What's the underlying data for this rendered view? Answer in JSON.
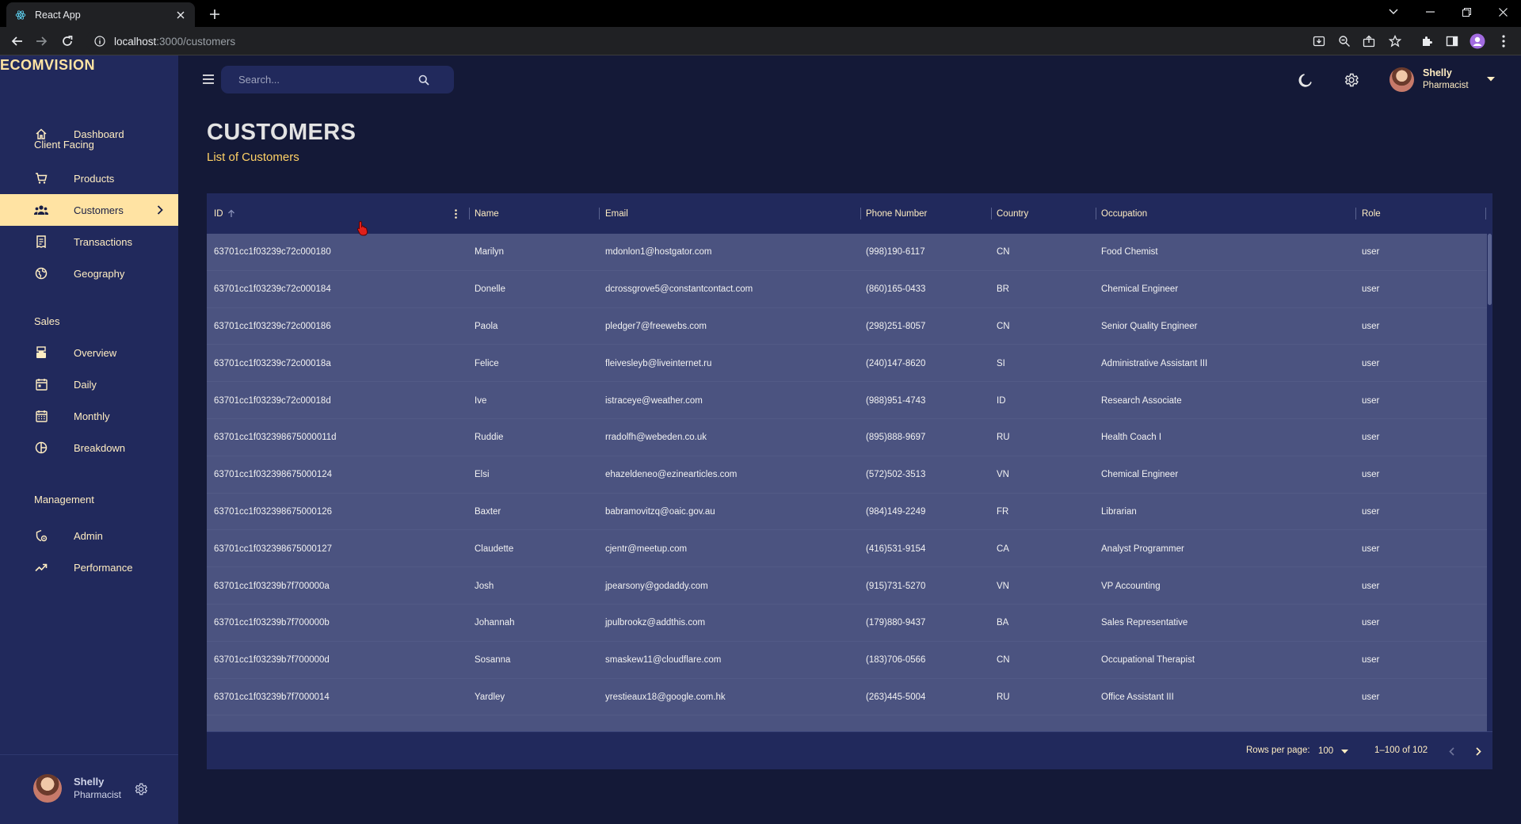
{
  "browser": {
    "tab_title": "React App",
    "url_host": "localhost",
    "url_path": ":3000/customers"
  },
  "sidebar": {
    "brand": "ECOMVISION",
    "items": [
      {
        "label": "Dashboard",
        "icon": "home-icon"
      },
      {
        "section": "Client Facing"
      },
      {
        "label": "Products",
        "icon": "shopping-cart-icon"
      },
      {
        "label": "Customers",
        "icon": "groups-icon",
        "active": true
      },
      {
        "label": "Transactions",
        "icon": "receipt-icon"
      },
      {
        "label": "Geography",
        "icon": "globe-icon"
      },
      {
        "section": "Sales"
      },
      {
        "label": "Overview",
        "icon": "point-of-sale-icon"
      },
      {
        "label": "Daily",
        "icon": "calendar-today-icon"
      },
      {
        "label": "Monthly",
        "icon": "calendar-month-icon"
      },
      {
        "label": "Breakdown",
        "icon": "pie-chart-icon"
      },
      {
        "section": "Management"
      },
      {
        "label": "Admin",
        "icon": "admin-panel-icon"
      },
      {
        "label": "Performance",
        "icon": "trending-up-icon"
      }
    ],
    "user": {
      "name": "Shelly",
      "role": "Pharmacist"
    }
  },
  "topbar": {
    "search_placeholder": "Search...",
    "user": {
      "name": "Shelly",
      "role": "Pharmacist"
    }
  },
  "header": {
    "title": "CUSTOMERS",
    "subtitle": "List of Customers"
  },
  "grid": {
    "columns": [
      "ID",
      "Name",
      "Email",
      "Phone Number",
      "Country",
      "Occupation",
      "Role"
    ],
    "rows": [
      [
        "63701cc1f03239c72c000180",
        "Marilyn",
        "mdonlon1@hostgator.com",
        "(998)190-6117",
        "CN",
        "Food Chemist",
        "user"
      ],
      [
        "63701cc1f03239c72c000184",
        "Donelle",
        "dcrossgrove5@constantcontact.com",
        "(860)165-0433",
        "BR",
        "Chemical Engineer",
        "user"
      ],
      [
        "63701cc1f03239c72c000186",
        "Paola",
        "pledger7@freewebs.com",
        "(298)251-8057",
        "CN",
        "Senior Quality Engineer",
        "user"
      ],
      [
        "63701cc1f03239c72c00018a",
        "Felice",
        "fleivesleyb@liveinternet.ru",
        "(240)147-8620",
        "SI",
        "Administrative Assistant III",
        "user"
      ],
      [
        "63701cc1f03239c72c00018d",
        "Ive",
        "istraceye@weather.com",
        "(988)951-4743",
        "ID",
        "Research Associate",
        "user"
      ],
      [
        "63701cc1f032398675000011d",
        "Ruddie",
        "rradolfh@webeden.co.uk",
        "(895)888-9697",
        "RU",
        "Health Coach I",
        "user"
      ],
      [
        "63701cc1f032398675000124",
        "Elsi",
        "ehazeldeneo@ezinearticles.com",
        "(572)502-3513",
        "VN",
        "Chemical Engineer",
        "user"
      ],
      [
        "63701cc1f032398675000126",
        "Baxter",
        "babramovitzq@oaic.gov.au",
        "(984)149-2249",
        "FR",
        "Librarian",
        "user"
      ],
      [
        "63701cc1f032398675000127",
        "Claudette",
        "cjentr@meetup.com",
        "(416)531-9154",
        "CA",
        "Analyst Programmer",
        "user"
      ],
      [
        "63701cc1f03239b7f700000a",
        "Josh",
        "jpearsony@godaddy.com",
        "(915)731-5270",
        "VN",
        "VP Accounting",
        "user"
      ],
      [
        "63701cc1f03239b7f700000b",
        "Johannah",
        "jpulbrookz@addthis.com",
        "(179)880-9437",
        "BA",
        "Sales Representative",
        "user"
      ],
      [
        "63701cc1f03239b7f700000d",
        "Sosanna",
        "smaskew11@cloudflare.com",
        "(183)706-0566",
        "CN",
        "Occupational Therapist",
        "user"
      ],
      [
        "63701cc1f03239b7f7000014",
        "Yardley",
        "yrestieaux18@google.com.hk",
        "(263)445-5004",
        "RU",
        "Office Assistant III",
        "user"
      ]
    ],
    "footer": {
      "rows_per_page_label": "Rows per page:",
      "rows_per_page_value": "100",
      "range": "1–100 of 102"
    }
  },
  "colors": {
    "background": "#141937",
    "panel": "#21295c",
    "accent": "#ffe3a3",
    "body_rows": "#4b5380"
  }
}
